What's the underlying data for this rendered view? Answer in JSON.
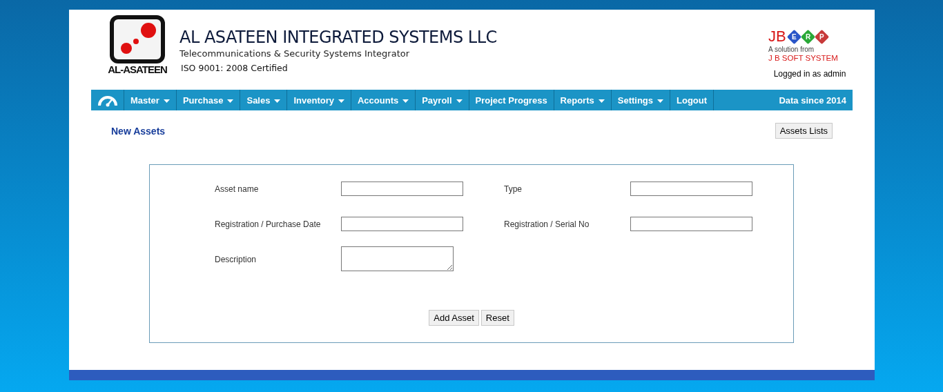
{
  "header": {
    "logo_caption": "AL-ASATEEN",
    "company_name": "AL ASATEEN INTEGRATED SYSTEMS LLC",
    "tagline": "Telecommunications & Security Systems Integrator",
    "certification": "ISO 9001: 2008 Certified",
    "erp_logo": {
      "brand": "JB",
      "tiles": [
        "E",
        "R",
        "P"
      ],
      "subtitle": "A solution from",
      "vendor": "J B SOFT SYSTEM"
    },
    "user_status": "Logged in as admin"
  },
  "menu": {
    "items": [
      {
        "label": "Master",
        "dropdown": true
      },
      {
        "label": "Purchase",
        "dropdown": true
      },
      {
        "label": "Sales",
        "dropdown": true
      },
      {
        "label": "Inventory",
        "dropdown": true
      },
      {
        "label": "Accounts",
        "dropdown": true
      },
      {
        "label": "Payroll",
        "dropdown": true
      },
      {
        "label": "Project Progress",
        "dropdown": false
      },
      {
        "label": "Reports",
        "dropdown": true
      },
      {
        "label": "Settings",
        "dropdown": true
      },
      {
        "label": "Logout",
        "dropdown": false
      }
    ],
    "info": "Data since 2014"
  },
  "page_title": "New Assets",
  "list_button": "Assets Lists",
  "form": {
    "fields": [
      {
        "label": "Asset name",
        "kind": "text"
      },
      {
        "label": "Type",
        "kind": "text"
      },
      {
        "label": "Registration / Purchase Date",
        "kind": "text"
      },
      {
        "label": "Registration / Serial No",
        "kind": "text"
      },
      {
        "label": "Description",
        "kind": "textarea"
      }
    ],
    "buttons": [
      "Add Asset",
      "Reset"
    ]
  }
}
